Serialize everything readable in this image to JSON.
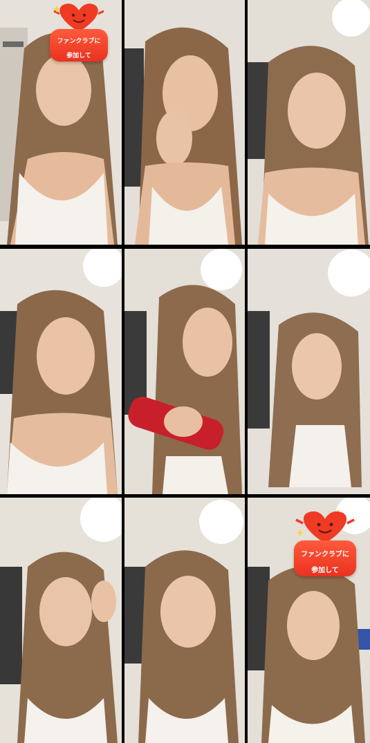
{
  "collage": {
    "rows": 3,
    "columns": 3,
    "frame_count": 9
  },
  "frames": [
    {
      "id": "frame-1",
      "has_badge": true
    },
    {
      "id": "frame-2",
      "has_badge": false
    },
    {
      "id": "frame-3",
      "has_badge": false
    },
    {
      "id": "frame-4",
      "has_badge": false
    },
    {
      "id": "frame-5",
      "has_badge": false
    },
    {
      "id": "frame-6",
      "has_badge": false
    },
    {
      "id": "frame-7",
      "has_badge": false
    },
    {
      "id": "frame-8",
      "has_badge": false
    },
    {
      "id": "frame-9",
      "has_badge": true
    }
  ],
  "badge": {
    "label_line1": "ファンクラブに",
    "label_line2": "参加して",
    "color": "#ef3b24"
  },
  "colors": {
    "divider": "#000000",
    "wall": "#e9e4dc",
    "light": "#ffffff",
    "hair": "#8a6a4e",
    "skin": "#e8c2a6",
    "top": "#f4f0ec"
  }
}
